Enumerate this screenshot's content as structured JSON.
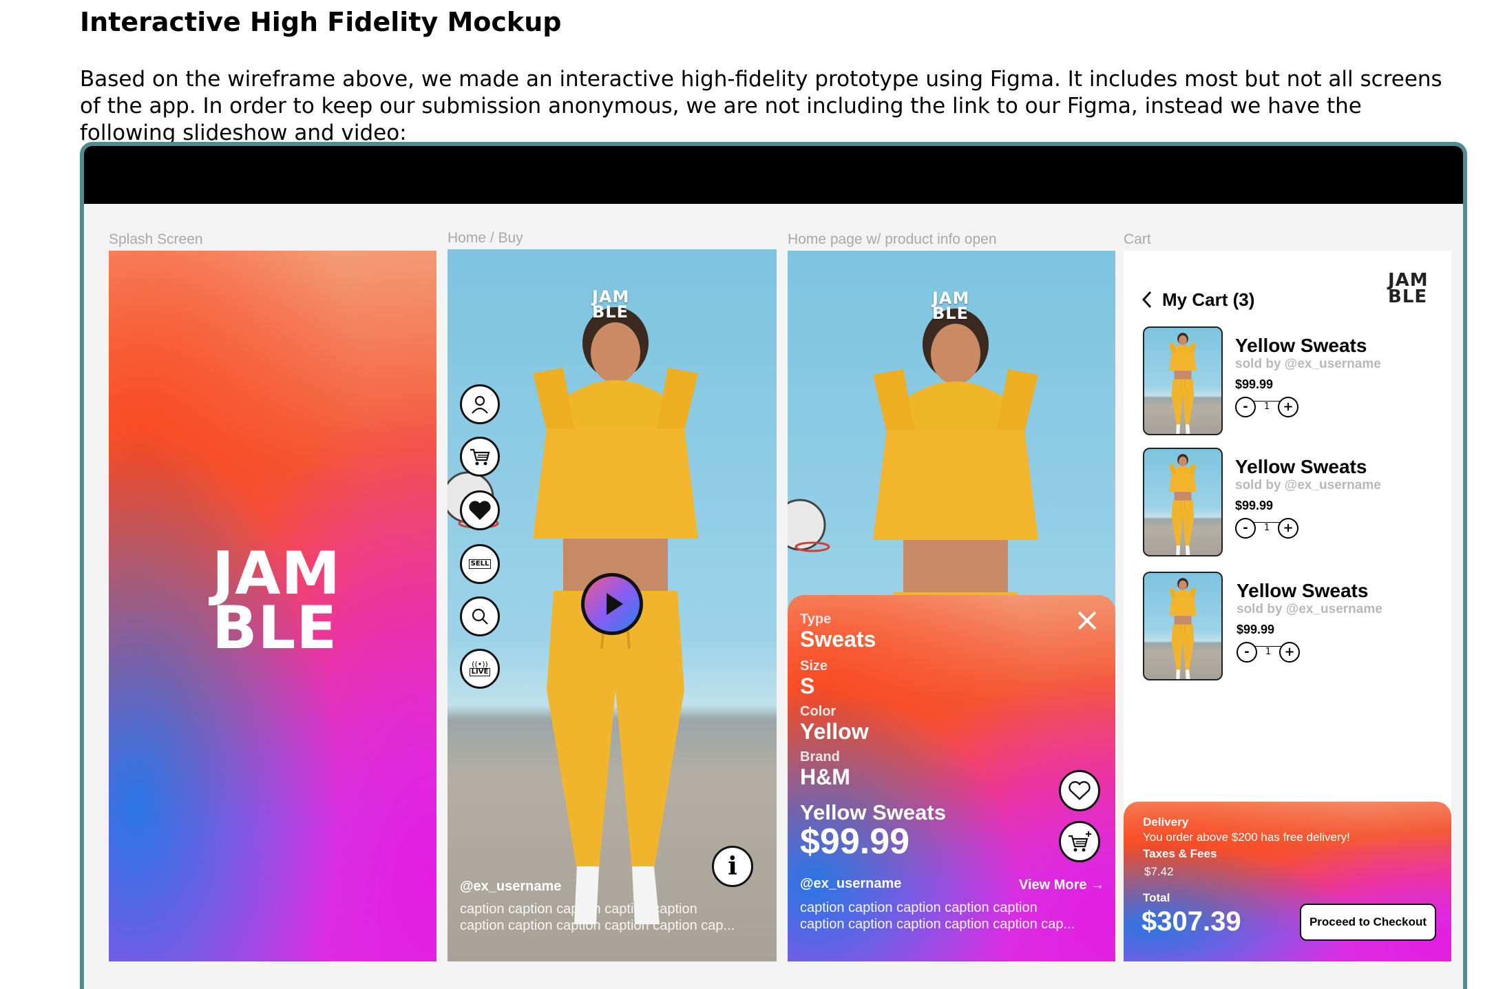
{
  "doc": {
    "heading": "Interactive High Fidelity Mockup",
    "intro": "Based on the wireframe above, we made an interactive high-fidelity prototype using Figma. It includes most but not all screens of the app. In order to keep our submission anonymous, we are not including the link to our Figma, instead we have the following slideshow and video:"
  },
  "screens": {
    "splash": {
      "label": "Splash Screen",
      "logo_line1": "JAM",
      "logo_line2": "BLE"
    },
    "home": {
      "label": "Home / Buy",
      "logo_line1": "JAM",
      "logo_line2": "BLE",
      "side_icons": [
        "profile-icon",
        "cart-icon",
        "heart-icon",
        "sell-icon",
        "search-icon",
        "live-icon"
      ],
      "sell_text": "SELL",
      "live_text": "LIVE",
      "username": "@ex_username",
      "caption_line1": "caption caption caption caption caption",
      "caption_line2": "caption caption caption caption caption cap..."
    },
    "product": {
      "label": "Home page w/ product info open",
      "logo_line1": "JAM",
      "logo_line2": "BLE",
      "type_label": "Type",
      "type_value": "Sweats",
      "size_label": "Size",
      "size_value": "S",
      "color_label": "Color",
      "color_value": "Yellow",
      "brand_label": "Brand",
      "brand_value": "H&M",
      "name": "Yellow Sweats",
      "price": "$99.99",
      "username": "@ex_username",
      "view_more": "View More →",
      "caption_line1": "caption caption caption caption caption",
      "caption_line2": "caption caption caption caption caption cap..."
    },
    "cart": {
      "label": "Cart",
      "title": "My Cart (3)",
      "logo_line1": "JAM",
      "logo_line2": "BLE",
      "items": [
        {
          "name": "Yellow Sweats",
          "seller": "sold by @ex_username",
          "price": "$99.99",
          "qty": "1"
        },
        {
          "name": "Yellow Sweats",
          "seller": "sold by @ex_username",
          "price": "$99.99",
          "qty": "1"
        },
        {
          "name": "Yellow Sweats",
          "seller": "sold by @ex_username",
          "price": "$99.99",
          "qty": "1"
        }
      ],
      "delivery_label": "Delivery",
      "delivery_note": "You order above $200 has free delivery!",
      "taxes_label": "Taxes & Fees",
      "taxes_value": "$7.42",
      "total_label": "Total",
      "total_value": "$307.39",
      "checkout_label": "Proceed to Checkout"
    }
  },
  "colors": {
    "frame_border": "#4f8c8f",
    "gradient_orange": "#f45a37",
    "gradient_pink": "#f0427b",
    "gradient_blue": "#2178e6",
    "gradient_magenta": "#e41ee1"
  }
}
